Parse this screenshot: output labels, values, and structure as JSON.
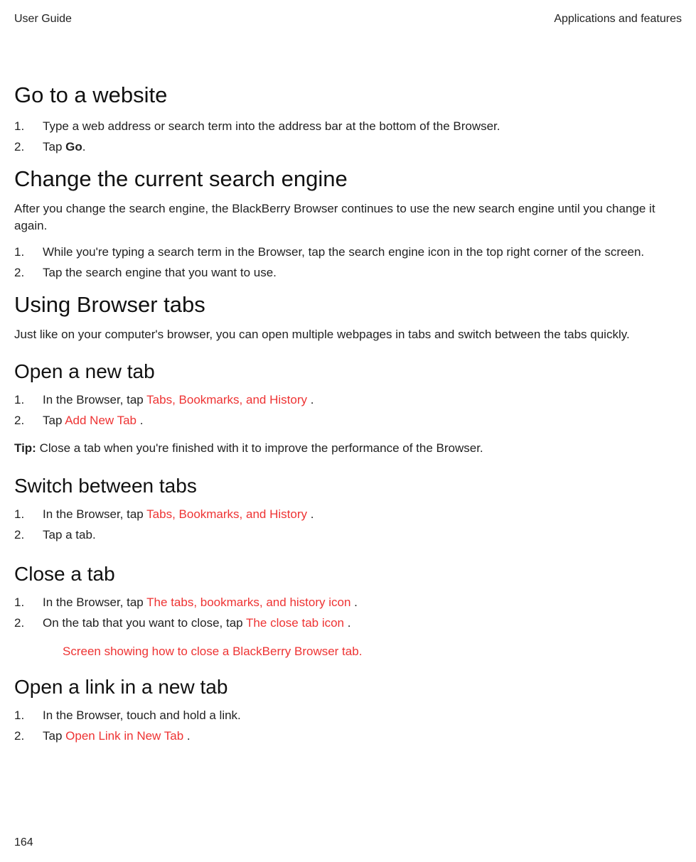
{
  "header": {
    "left": "User Guide",
    "right": "Applications and features"
  },
  "s1": {
    "title": "Go to a website",
    "steps": [
      {
        "n": "1.",
        "t": "Type a web address or search term into the address bar at the bottom of the Browser."
      },
      {
        "n": "2.",
        "t_pre": "Tap ",
        "bold": "Go",
        "t_post": "."
      }
    ]
  },
  "s2": {
    "title": "Change the current search engine",
    "intro": "After you change the search engine, the BlackBerry Browser continues to use the new search engine until you change it again.",
    "steps": [
      {
        "n": "1.",
        "t": "While you're typing a search term in the Browser, tap the search engine icon in the top right corner of the screen."
      },
      {
        "n": "2.",
        "t": "Tap the search engine that you want to use."
      }
    ]
  },
  "s3": {
    "title": "Using Browser tabs",
    "intro": "Just like on your computer's browser, you can open multiple webpages in tabs and switch between the tabs quickly."
  },
  "s4": {
    "title": "Open a new tab",
    "steps": [
      {
        "n": "1.",
        "t_pre": "In the Browser, tap  ",
        "red": "Tabs, Bookmarks, and History",
        "t_post": " ."
      },
      {
        "n": "2.",
        "t_pre": "Tap  ",
        "red": "Add New Tab",
        "t_post": " ."
      }
    ],
    "tip_label": "Tip:",
    "tip_body": " Close a tab when you're finished with it to improve the performance of the Browser."
  },
  "s5": {
    "title": "Switch between tabs",
    "steps": [
      {
        "n": "1.",
        "t_pre": "In the Browser, tap  ",
        "red": "Tabs, Bookmarks, and History",
        "t_post": " ."
      },
      {
        "n": "2.",
        "t": "Tap a tab."
      }
    ]
  },
  "s6": {
    "title": "Close a tab",
    "steps": [
      {
        "n": "1.",
        "t_pre": "In the Browser, tap  ",
        "red": "The tabs, bookmarks, and history icon",
        "t_post": " ."
      },
      {
        "n": "2.",
        "t_pre": "On the tab that you want to close, tap  ",
        "red": "The close tab icon",
        "t_post": " ."
      }
    ],
    "figref": "Screen showing how to close a BlackBerry Browser tab."
  },
  "s7": {
    "title": "Open a link in a new tab",
    "steps": [
      {
        "n": "1.",
        "t": "In the Browser, touch and hold a link."
      },
      {
        "n": "2.",
        "t_pre": "Tap  ",
        "red": "Open Link in New Tab",
        "t_post": " ."
      }
    ]
  },
  "pagenum": "164"
}
